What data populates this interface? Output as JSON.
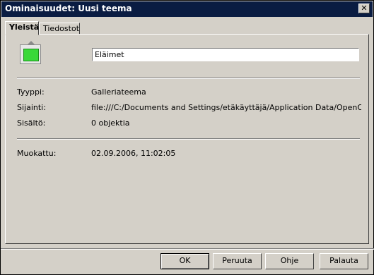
{
  "window": {
    "title": "Ominaisuudet: Uusi teema",
    "close_label": "✕"
  },
  "tabs": [
    {
      "label": "Yleistä"
    },
    {
      "label": "Tiedostot"
    }
  ],
  "general": {
    "name_value": "Eläimet",
    "type_label": "Tyyppi:",
    "type_value": "Galleriateema",
    "location_label": "Sijainti:",
    "location_value": "file:///C:/Documents and Settings/etäkäyttäjä/Application Data/OpenOffice.org",
    "content_label": "Sisältö:",
    "content_value": "0 objektia",
    "modified_label": "Muokattu:",
    "modified_value": "02.09.2006, 11:02:05"
  },
  "buttons": {
    "ok": "OK",
    "cancel": "Peruuta",
    "help": "Ohje",
    "reset": "Palauta"
  },
  "colors": {
    "titlebar": "#0a1c42",
    "icon_fill": "#3ad83a"
  }
}
